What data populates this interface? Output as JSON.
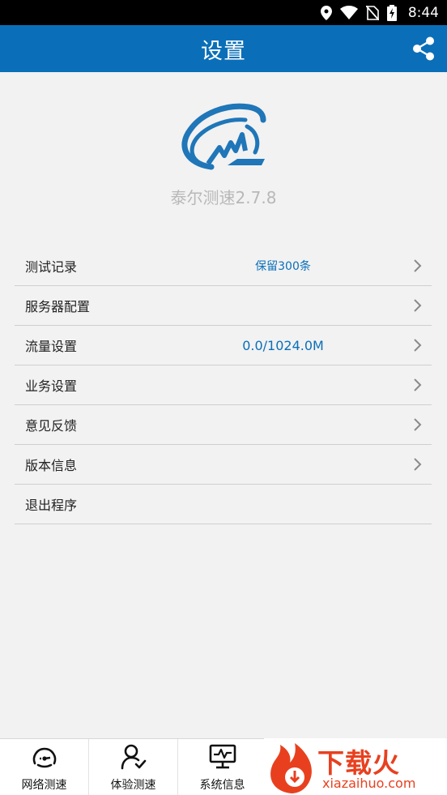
{
  "status_bar": {
    "time": "8:44",
    "icons": [
      "location-icon",
      "wifi-icon",
      "no-sim-icon",
      "battery-charging-icon"
    ]
  },
  "header": {
    "title": "设置",
    "share_icon": "share-icon"
  },
  "app_info": {
    "version_text": "泰尔测速2.7.8"
  },
  "settings": {
    "items": [
      {
        "label": "测试记录",
        "value": "保留300条",
        "has_chevron": true
      },
      {
        "label": "服务器配置",
        "value": "",
        "has_chevron": true
      },
      {
        "label": "流量设置",
        "value": "0.0/1024.0M",
        "has_chevron": true
      },
      {
        "label": "业务设置",
        "value": "",
        "has_chevron": true
      },
      {
        "label": "意见反馈",
        "value": "",
        "has_chevron": true
      },
      {
        "label": "版本信息",
        "value": "",
        "has_chevron": true
      },
      {
        "label": "退出程序",
        "value": "",
        "has_chevron": false
      }
    ]
  },
  "bottom_nav": {
    "items": [
      {
        "label": "网络测速",
        "icon": "speedometer-icon"
      },
      {
        "label": "体验测速",
        "icon": "user-check-icon"
      },
      {
        "label": "系统信息",
        "icon": "monitor-icon"
      }
    ]
  },
  "watermark": {
    "main": "下载火",
    "sub": "xiazaihuo.com"
  },
  "colors": {
    "primary": "#0a6fb8",
    "background": "#f2f2f2",
    "watermark": "#e8401f"
  }
}
